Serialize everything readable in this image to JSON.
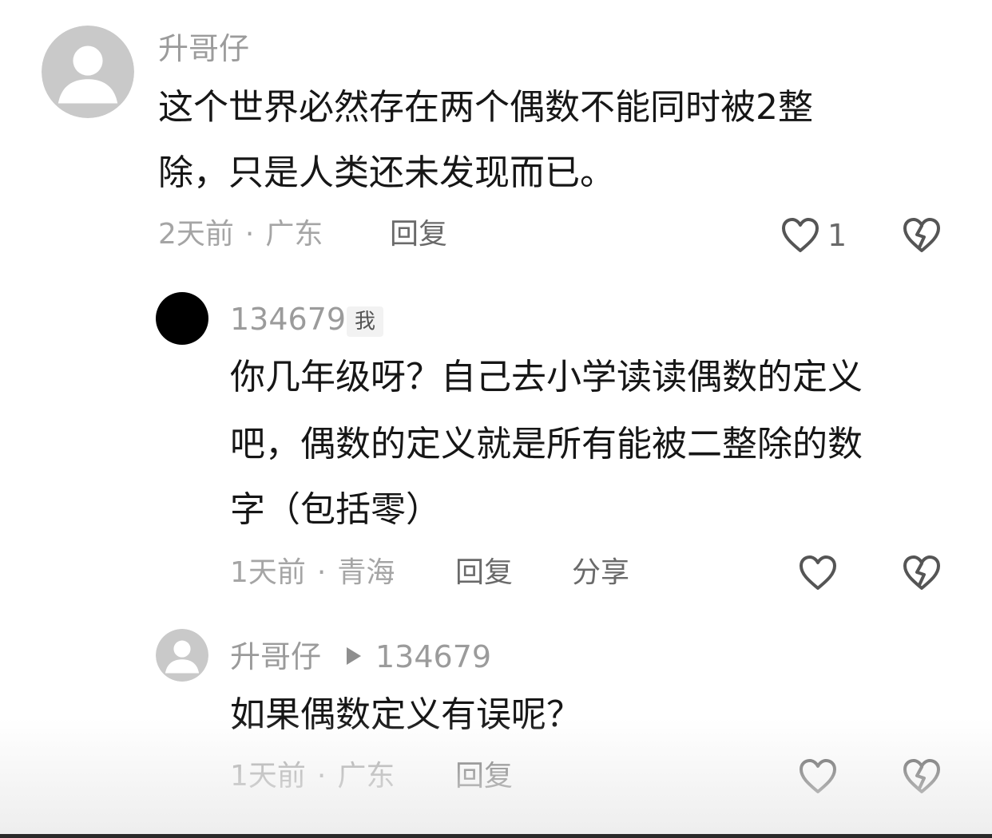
{
  "comments": [
    {
      "username": "升哥仔",
      "lines": [
        "这个世界必然存在两个偶数不能同时被2整",
        "除，只是人类还未发现而已。"
      ],
      "time": "2天前",
      "location": "广东",
      "reply_label": "回复",
      "like_count": "1"
    },
    {
      "username": "134679",
      "badge": "我",
      "lines": [
        "你几年级呀？自己去小学读读偶数的定义",
        "吧，偶数的定义就是所有能被二整除的数",
        "字（包括零）"
      ],
      "time": "1天前",
      "location": "青海",
      "reply_label": "回复",
      "share_label": "分享"
    },
    {
      "username": "升哥仔",
      "reply_to": "134679",
      "lines": [
        "如果偶数定义有误呢？"
      ],
      "time": "1天前",
      "location": "广东",
      "reply_label": "回复"
    }
  ],
  "separator": "·",
  "icons": {
    "like": "heart-outline-icon",
    "dislike": "broken-heart-icon",
    "reply_indicator": "play-triangle-icon",
    "avatar_default": "default-user-avatar"
  },
  "colors": {
    "text": "#161616",
    "meta": "#a5a5a5",
    "username": "#9b9b9b",
    "icon": "#555555"
  }
}
